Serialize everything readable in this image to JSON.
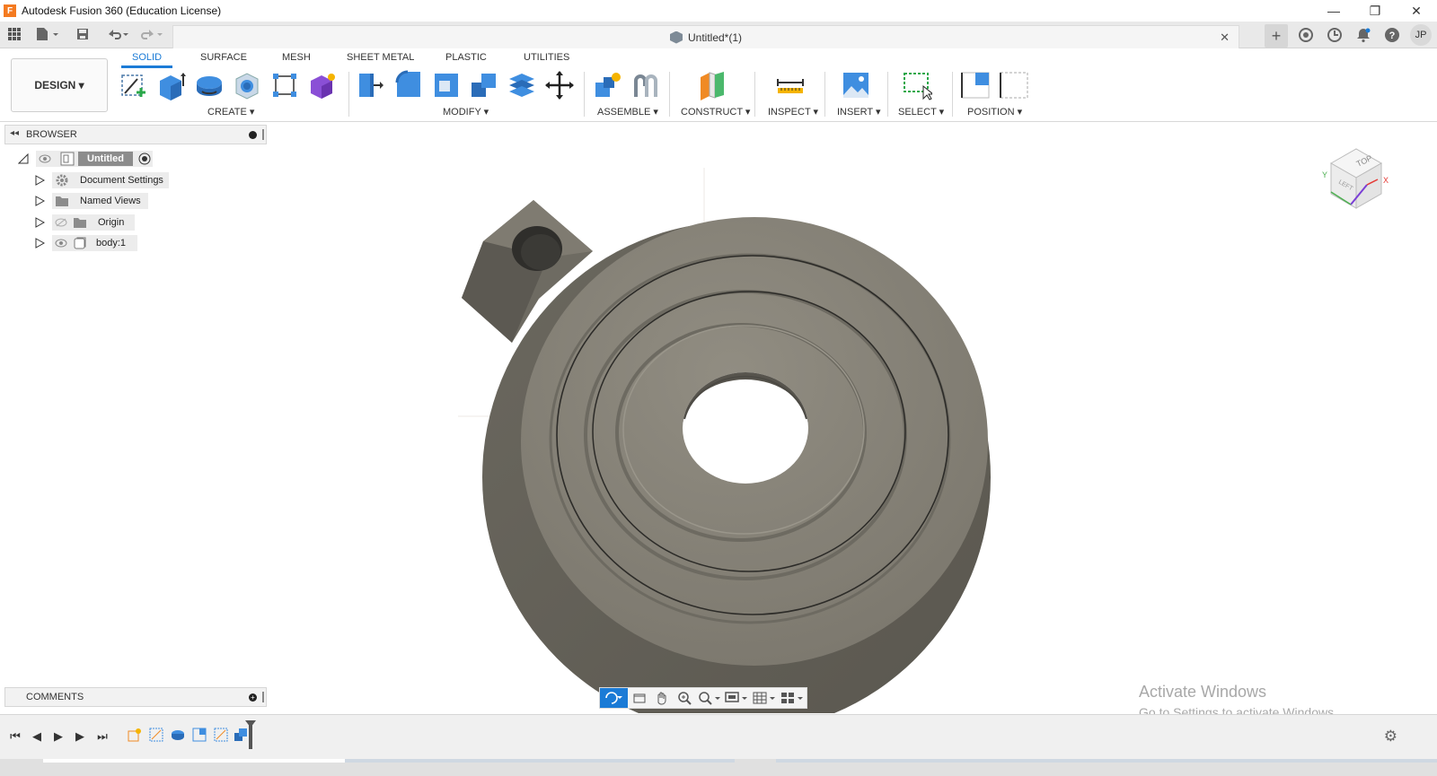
{
  "window": {
    "title": "Autodesk Fusion 360 (Education License)",
    "logo_letter": "F",
    "minimize": "—",
    "maximize": "❐",
    "close": "✕"
  },
  "document": {
    "tab_title": "Untitled*(1)",
    "close": "✕",
    "new_tab": "+",
    "user_initials": "JP"
  },
  "workspace": {
    "label": "DESIGN ▾"
  },
  "toolbar_tabs": [
    {
      "label": "SOLID",
      "active": true
    },
    {
      "label": "SURFACE"
    },
    {
      "label": "MESH"
    },
    {
      "label": "SHEET METAL"
    },
    {
      "label": "PLASTIC"
    },
    {
      "label": "UTILITIES"
    }
  ],
  "tool_groups": [
    {
      "label": "CREATE ▾"
    },
    {
      "label": "MODIFY ▾"
    },
    {
      "label": "ASSEMBLE ▾"
    },
    {
      "label": "CONSTRUCT ▾"
    },
    {
      "label": "INSPECT ▾"
    },
    {
      "label": "INSERT ▾"
    },
    {
      "label": "SELECT ▾"
    },
    {
      "label": "POSITION ▾"
    }
  ],
  "browser": {
    "header": "BROWSER",
    "root": "Untitled",
    "items": [
      {
        "label": "Document Settings",
        "icon": "gear-icon"
      },
      {
        "label": "Named Views",
        "icon": "folder-icon"
      },
      {
        "label": "Origin",
        "icon": "folder-icon"
      },
      {
        "label": "body:1",
        "icon": "body-icon"
      }
    ]
  },
  "comments": {
    "header": "COMMENTS"
  },
  "viewcube": {
    "top_label": "TOP",
    "left_label": "LEFT"
  },
  "watermark": {
    "line1": "Activate Windows",
    "line2": "Go to Settings to activate Windows."
  },
  "colors": {
    "accent": "#1b7bd6",
    "model": "#7f7b70",
    "model_dark": "#5b5850"
  }
}
